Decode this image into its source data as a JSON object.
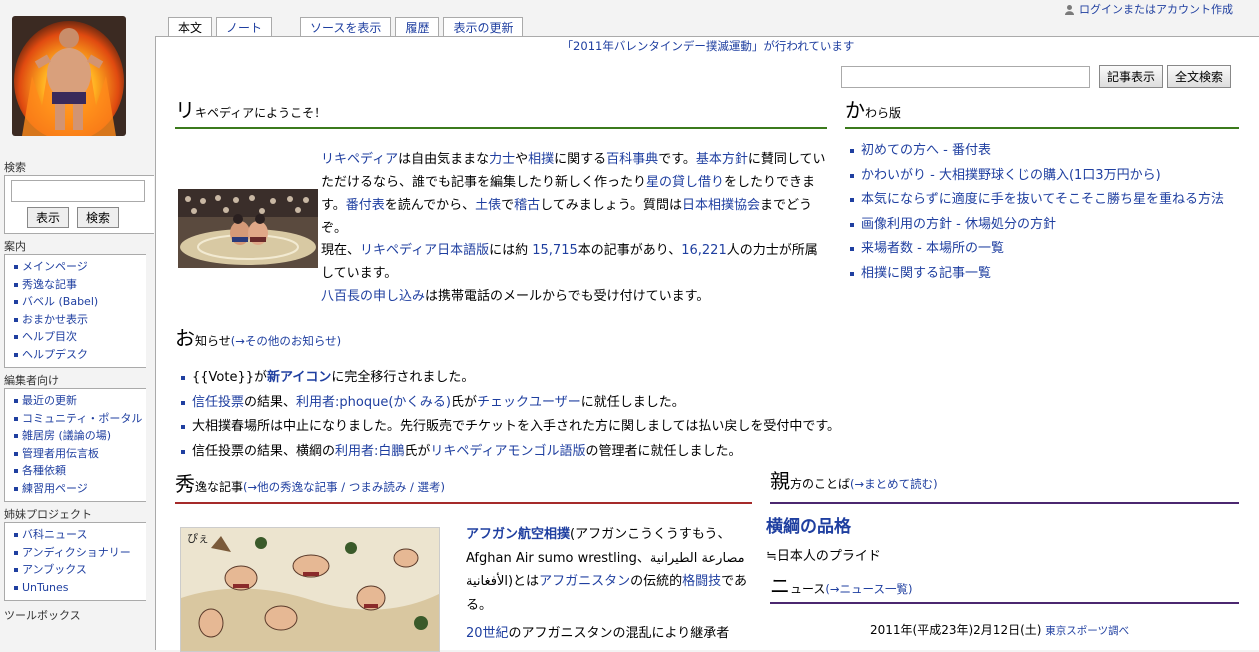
{
  "personal": {
    "login_label": "ログインまたはアカウント作成"
  },
  "logo": {
    "alt_name": "wiki-logo"
  },
  "tabs": [
    {
      "label": "本文",
      "selected": true
    },
    {
      "label": "ノート",
      "selected": false
    },
    {
      "label": "ソースを表示",
      "selected": false
    },
    {
      "label": "履歴",
      "selected": false
    },
    {
      "label": "表示の更新",
      "selected": false
    }
  ],
  "site_notice": "「2011年バレンタインデー撲滅運動」が行われています",
  "top_search": {
    "value": "",
    "article_button": "記事表示",
    "fulltext_button": "全文検索"
  },
  "sidebar": {
    "search": {
      "heading": "検索",
      "value": "",
      "go_button": "表示",
      "search_button": "検索"
    },
    "nav": {
      "heading": "案内",
      "items": [
        "メインページ",
        "秀逸な記事",
        "バベル (Babel)",
        "おまかせ表示",
        "ヘルプ目次",
        "ヘルプデスク"
      ]
    },
    "editors": {
      "heading": "編集者向け",
      "items": [
        "最近の更新",
        "コミュニティ・ポータル",
        "雑居房 (議論の場)",
        "管理者用伝言板",
        "各種依頼",
        "練習用ページ"
      ]
    },
    "sister": {
      "heading": "姉妹プロジェクト",
      "items": [
        "バ科ニュース",
        "アンディクショナリー",
        "アンブックス",
        "UnTunes"
      ]
    },
    "toolbox": {
      "heading": "ツールボックス"
    }
  },
  "welcome": {
    "heading_big": "リ",
    "heading_rest": "キペディアにようこそ！",
    "p1_parts": [
      {
        "t": "リキペディア",
        "link": true
      },
      {
        "t": "は自由気ままな",
        "link": false
      },
      {
        "t": "力士",
        "link": true
      },
      {
        "t": "や",
        "link": false
      },
      {
        "t": "相撲",
        "link": true
      },
      {
        "t": "に関する",
        "link": false
      },
      {
        "t": "百科事典",
        "link": true
      },
      {
        "t": "です。",
        "link": false
      },
      {
        "t": "基本方針",
        "link": true
      },
      {
        "t": "に賛同していただけるなら、誰でも記事を編集したり新しく作ったり",
        "link": false
      },
      {
        "t": "星の貸し借り",
        "link": true
      },
      {
        "t": "をしたりできます。",
        "link": false
      },
      {
        "t": "番付表",
        "link": true
      },
      {
        "t": "を読んでから、",
        "link": false
      },
      {
        "t": "土俵",
        "link": true
      },
      {
        "t": "で",
        "link": false
      },
      {
        "t": "稽古",
        "link": true
      },
      {
        "t": "してみましょう。質問は",
        "link": false
      },
      {
        "t": "日本相撲協会",
        "link": true
      },
      {
        "t": "までどうぞ。",
        "link": false
      }
    ],
    "p2_parts": [
      {
        "t": "現在、",
        "link": false
      },
      {
        "t": "リキペディア日本語版",
        "link": true
      },
      {
        "t": "には約 ",
        "link": false
      },
      {
        "t": "15,715",
        "link": true
      },
      {
        "t": "本の記事があり、",
        "link": false
      },
      {
        "t": "16,221",
        "link": true
      },
      {
        "t": "人の力士が所属しています。",
        "link": false
      }
    ],
    "p3_parts": [
      {
        "t": "八百長の申し込み",
        "link": true
      },
      {
        "t": "は携帯電話のメールからでも受け付けています。",
        "link": false
      }
    ]
  },
  "kawara": {
    "heading_big": "か",
    "heading_rest": "わら版",
    "items": [
      "初めての方へ - 番付表",
      "かわいがり - 大相撲野球くじの購入(1口3万円から)",
      "本気にならずに適度に手を抜いてそこそこ勝ち星を重ねる方法",
      "画像利用の方針 - 休場処分の方針",
      "来場者数 - 本場所の一覧",
      "相撲に関する記事一覧"
    ]
  },
  "notice": {
    "heading_big": "お",
    "heading_rest": "知らせ",
    "more": "(→その他のお知らせ)",
    "items": [
      [
        {
          "t": "{{Vote}}が",
          "link": false
        },
        {
          "t": "新アイコン",
          "link": true,
          "bold": true
        },
        {
          "t": "に完全移行されました。",
          "link": false
        }
      ],
      [
        {
          "t": "信任投票",
          "link": true
        },
        {
          "t": "の結果、",
          "link": false
        },
        {
          "t": "利用者:phoque(かくみる)",
          "link": true
        },
        {
          "t": "氏が",
          "link": false
        },
        {
          "t": "チェックユーザー",
          "link": true
        },
        {
          "t": "に就任しました。",
          "link": false
        }
      ],
      [
        {
          "t": "大相撲春場所は中止になりました。先行販売でチケットを入手された方に関しましては払い戻しを受付中です。",
          "link": false
        }
      ],
      [
        {
          "t": "信任投票の結果、横綱の",
          "link": false
        },
        {
          "t": "利用者:白鵬",
          "link": true
        },
        {
          "t": "氏が",
          "link": false
        },
        {
          "t": "リキペディアモンゴル語版",
          "link": true
        },
        {
          "t": "の管理者に就任しました。",
          "link": false
        }
      ]
    ]
  },
  "featured": {
    "heading_big": "秀",
    "heading_rest": "逸な記事",
    "more": "(→他の秀逸な記事 / つまみ読み / 選考)",
    "text_parts": [
      {
        "t": "アフガン航空相撲",
        "link": true,
        "bold": true
      },
      {
        "t": "(アフガンこうくうすもう、Afghan Air sumo wrestling、",
        "link": false
      },
      {
        "t": "مصارعة الطيرانية الأفغانية",
        "link": false
      },
      {
        "t": ")とは",
        "link": false
      },
      {
        "t": "アフガニスタン",
        "link": true
      },
      {
        "t": "の伝統的",
        "link": false
      },
      {
        "t": "格闘技",
        "link": true
      },
      {
        "t": "である。",
        "link": false
      }
    ],
    "text2_parts": [
      {
        "t": "20世紀",
        "link": true
      },
      {
        "t": "のアフガニスタンの混乱により継承者",
        "link": false
      }
    ]
  },
  "oyakata": {
    "heading_big": "親",
    "heading_rest": "方のことば",
    "more": "(→まとめて読む)",
    "title": "横綱の品格",
    "text": "≒日本人のプライド"
  },
  "news": {
    "heading_big": "ニ",
    "heading_rest": "ュース",
    "more": "(→ニュース一覧)",
    "date": "2011年(平成23年)2月12日(土)",
    "source": "東京スポーツ調べ"
  },
  "colors": {
    "link": "#1f3fa0",
    "green_rule": "#3b7a1c",
    "red_rule": "#a52a2a",
    "purple_rule": "#4b2770"
  }
}
